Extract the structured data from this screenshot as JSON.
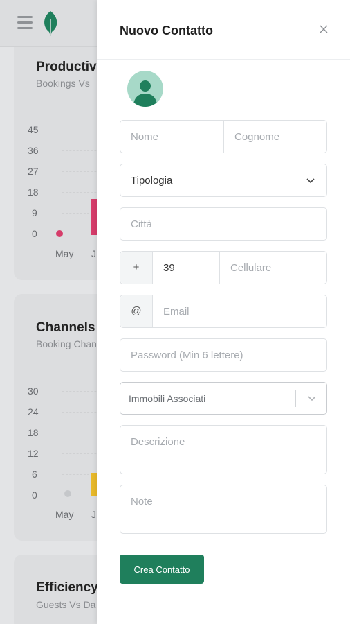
{
  "background": {
    "cards": [
      {
        "title": "Productiv",
        "subtitle": "Bookings Vs",
        "y_ticks": [
          "45",
          "36",
          "27",
          "18",
          "9",
          "0"
        ],
        "x_ticks": [
          "May",
          "J"
        ]
      },
      {
        "title": "Channels",
        "subtitle": "Booking Chan",
        "y_ticks": [
          "30",
          "24",
          "18",
          "12",
          "6",
          "0"
        ],
        "x_ticks": [
          "May",
          "J"
        ]
      },
      {
        "title": "Efficiency",
        "subtitle": "Guests Vs Da"
      }
    ]
  },
  "drawer": {
    "title": "Nuovo Contatto",
    "fields": {
      "nome_placeholder": "Nome",
      "cognome_placeholder": "Cognome",
      "tipologia_value": "Tipologia",
      "citta_placeholder": "Città",
      "phone_prefix": "+",
      "phone_code": "39",
      "cellulare_placeholder": "Cellulare",
      "email_prefix": "@",
      "email_placeholder": "Email",
      "password_placeholder": "Password (Min 6 lettere)",
      "immobili_placeholder": "Immobili Associati",
      "descrizione_placeholder": "Descrizione",
      "note_placeholder": "Note"
    },
    "submit_label": "Crea Contatto"
  },
  "colors": {
    "accent": "#1f7f5c",
    "avatar_bg": "#a7d9c8",
    "avatar_fg": "#1f7f5c",
    "bar_pink": "#d63c6a",
    "bar_yellow": "#e8b92a"
  }
}
